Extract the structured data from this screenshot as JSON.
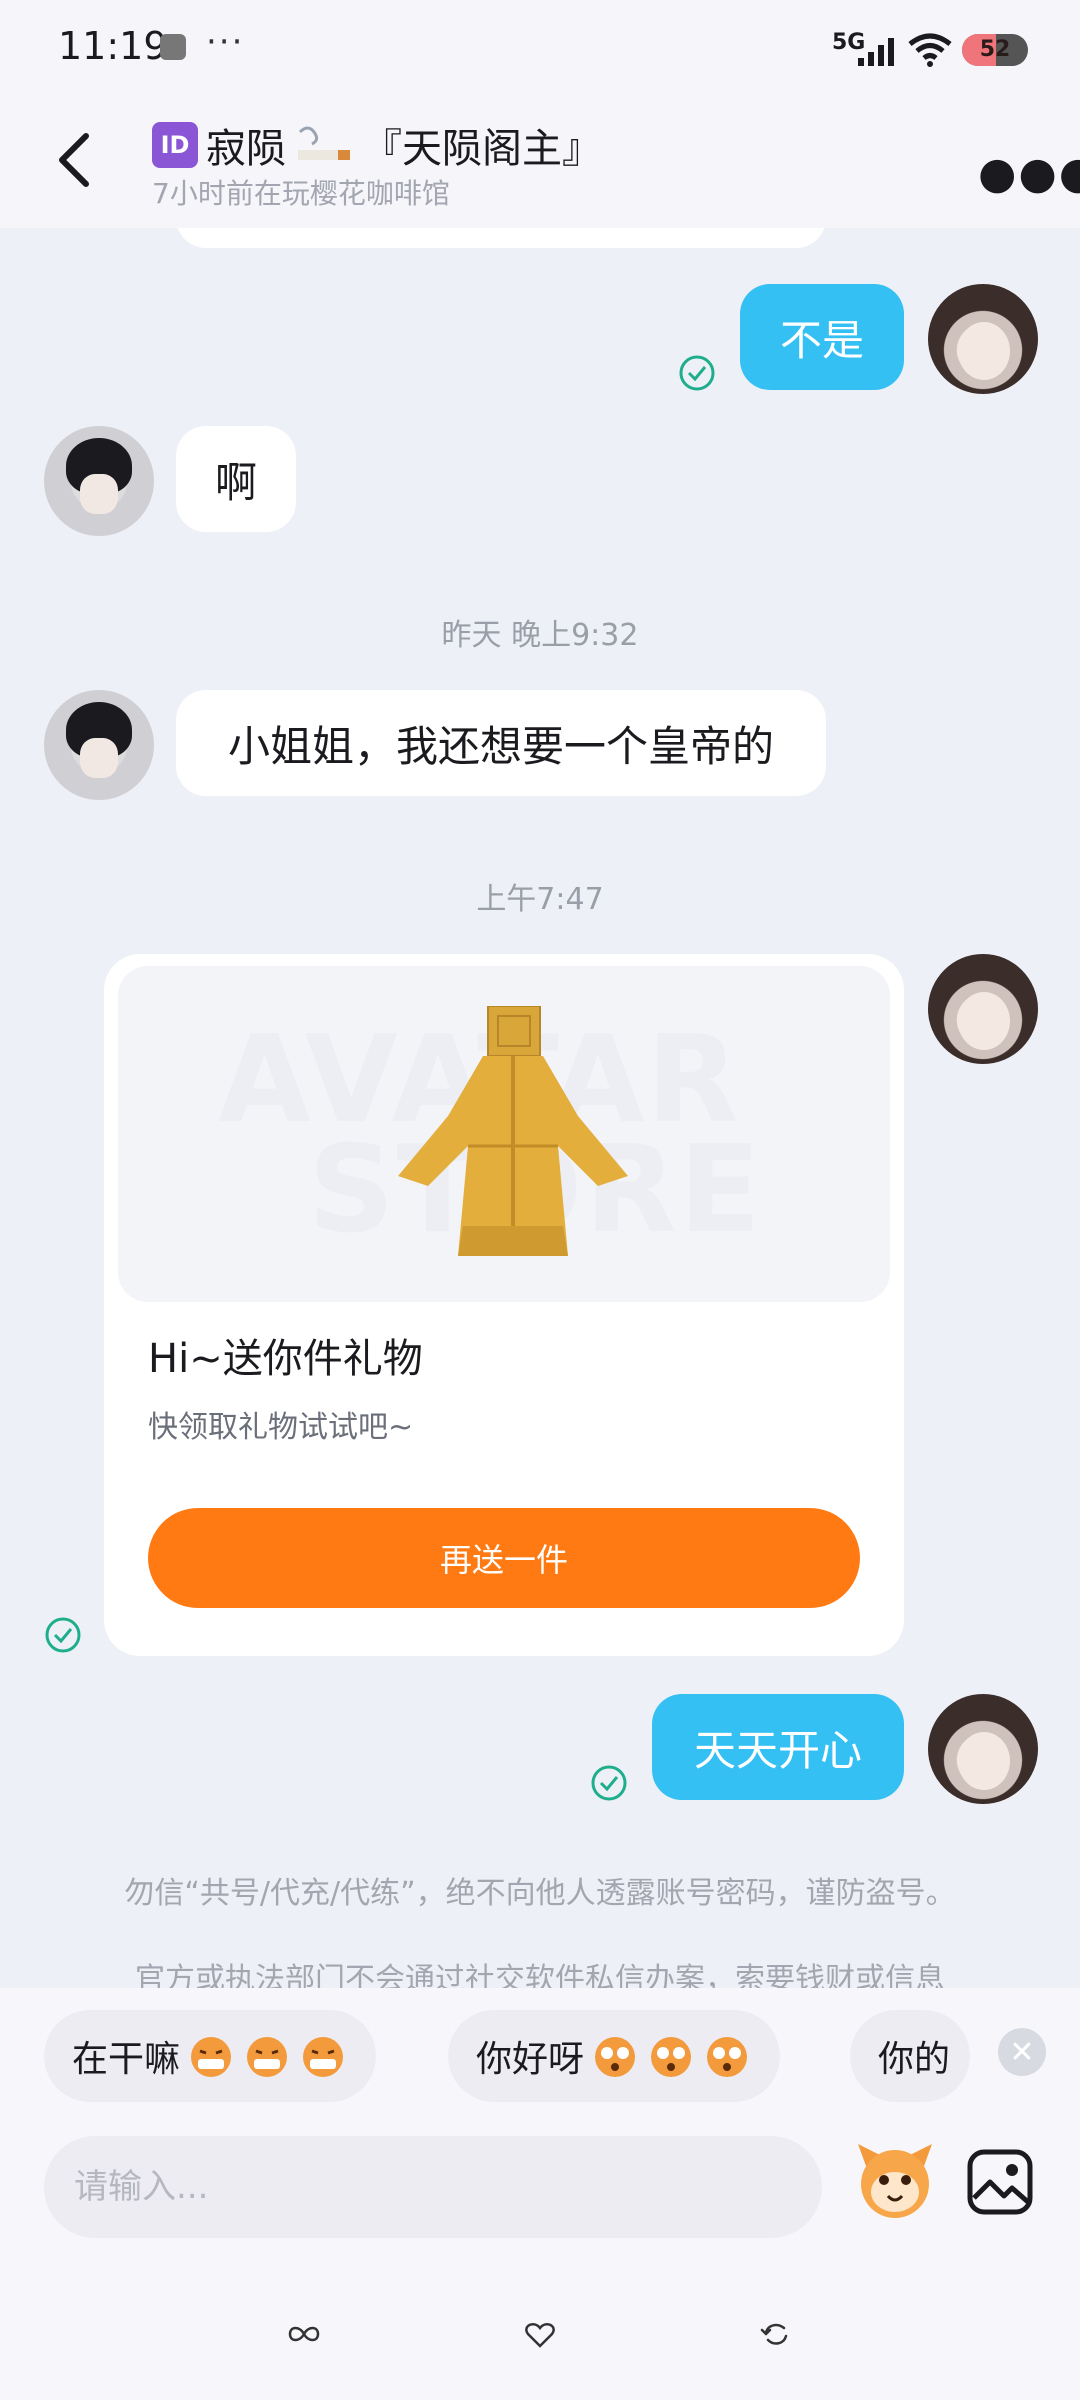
{
  "status_bar": {
    "time": "11:19",
    "more": "···",
    "network": "5G",
    "battery": 52
  },
  "header": {
    "badge": "ID",
    "name": "寂陨",
    "tag": "『天陨阁主』",
    "subtitle": "7小时前在玩樱花咖啡馆"
  },
  "messages": {
    "msg1": "不是",
    "msg2": "啊",
    "time1": "昨天 晚上9:32",
    "msg3": "小姐姐，我还想要一个皇帝的",
    "time2": "上午7:47",
    "gift": {
      "watermark_line1": "AVATAR",
      "watermark_line2": "STORE",
      "title": "Hi~送你件礼物",
      "desc": "快领取礼物试试吧~",
      "button": "再送一件"
    },
    "msg4": "天天开心"
  },
  "notices": [
    "勿信“共号/代充/代练”，绝不向他人透露账号密码，谨防盗号。",
    "官方或执法部门不会通过社交软件私信办案，索要钱财或信息"
  ],
  "quick_replies": [
    "在干嘛",
    "你好呀",
    "你的"
  ],
  "input": {
    "placeholder": "请输入..."
  },
  "colors": {
    "my_bubble": "#34c0f3",
    "gift_button": "#ff7a12",
    "check": "#1fae8c"
  },
  "icons": [
    "back-icon",
    "more-icon",
    "check-icon",
    "emoji-button-icon",
    "image-icon",
    "close-icon"
  ]
}
